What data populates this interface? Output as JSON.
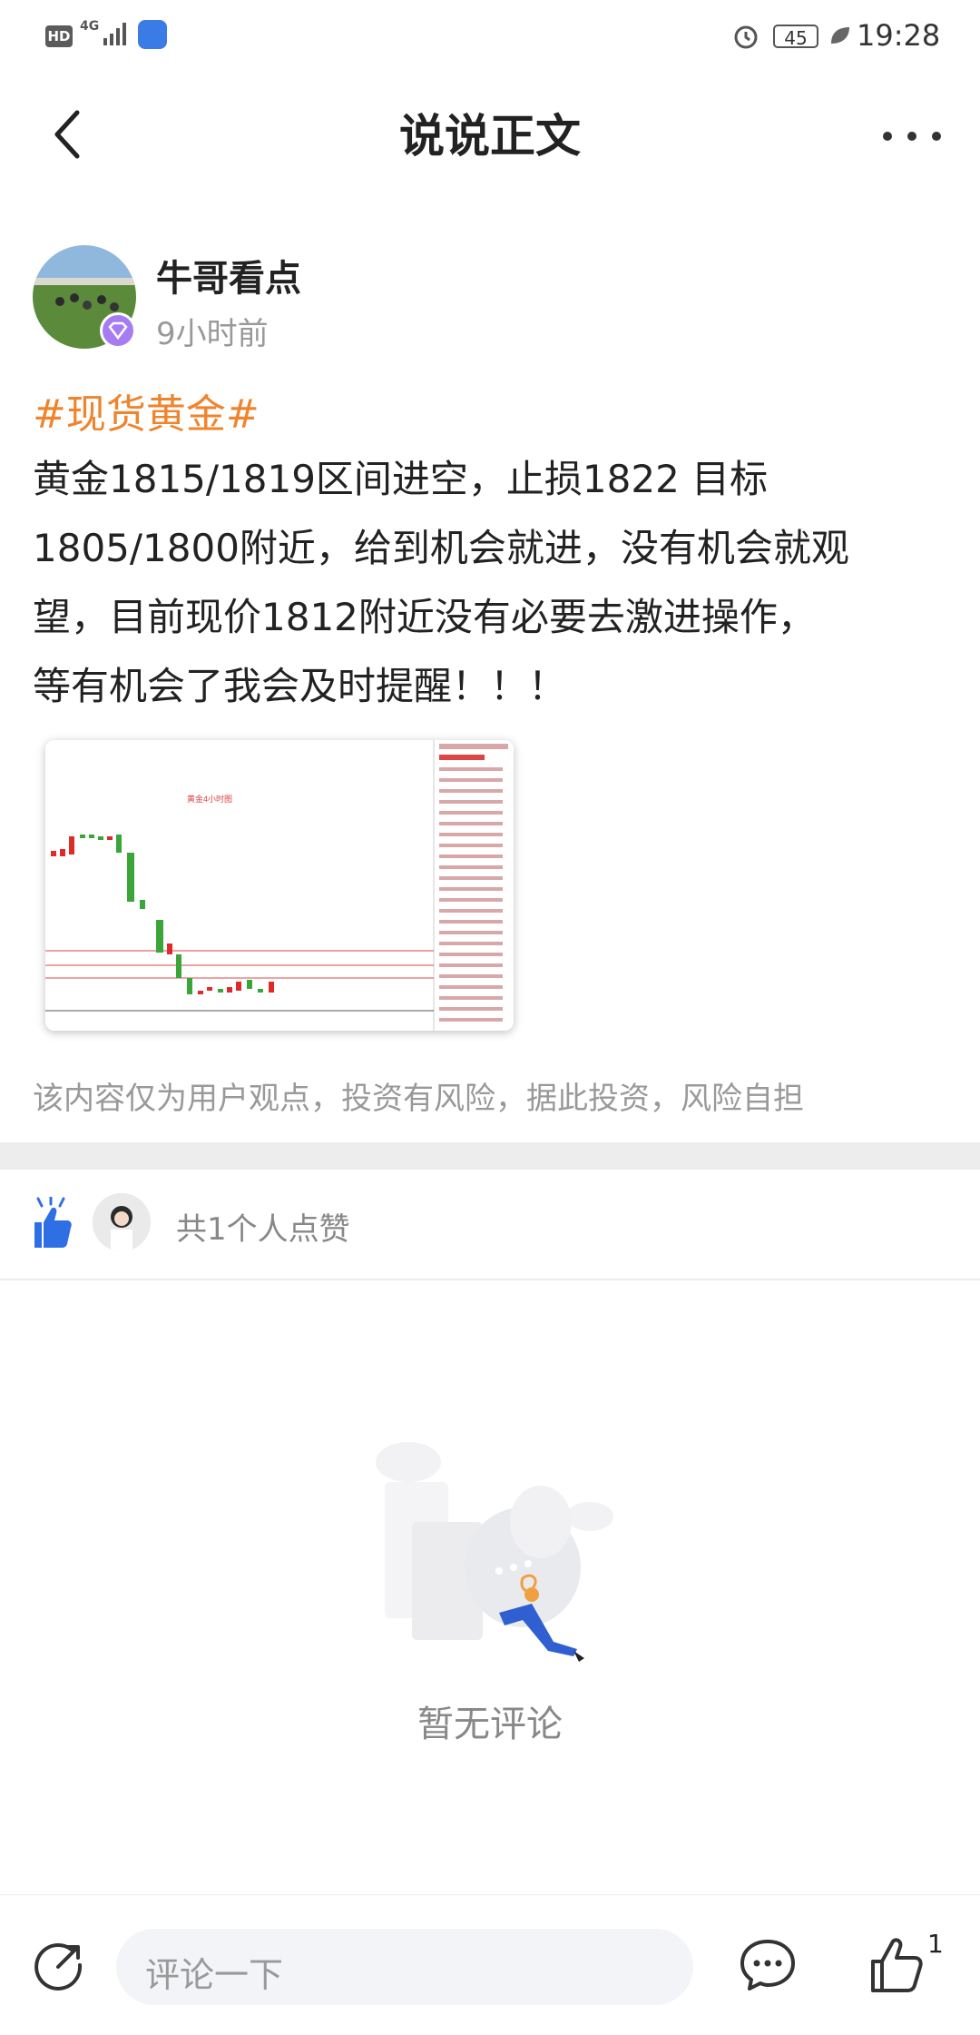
{
  "status_bar": {
    "hd": "HD",
    "network": "4G",
    "battery": "45",
    "time": "19:28"
  },
  "header": {
    "title": "说说正文"
  },
  "post": {
    "author": "牛哥看点",
    "time_ago": "9小时前",
    "hashtag": "#现货黄金#",
    "lines": [
      "黄金1815/1819区间进空，止损1822  目标",
      "1805/1800附近，给到机会就进，没有机会就观",
      "望，目前现价1812附近没有必要去激进操作，",
      "等有机会了我会及时提醒！！！"
    ],
    "chart_caption": "黄金4小时图",
    "disclaimer": "该内容仅为用户观点，投资有风险，据此投资，风险自担"
  },
  "likes": {
    "text": "共1个人点赞"
  },
  "comments": {
    "empty_text": "暂无评论"
  },
  "bottom_bar": {
    "input_placeholder": "评论一下",
    "like_count": "1"
  },
  "colors": {
    "accent": "#f0842c",
    "like_blue": "#2f6fe6",
    "up_red": "#e02a2a",
    "down_green": "#3aa63a"
  }
}
